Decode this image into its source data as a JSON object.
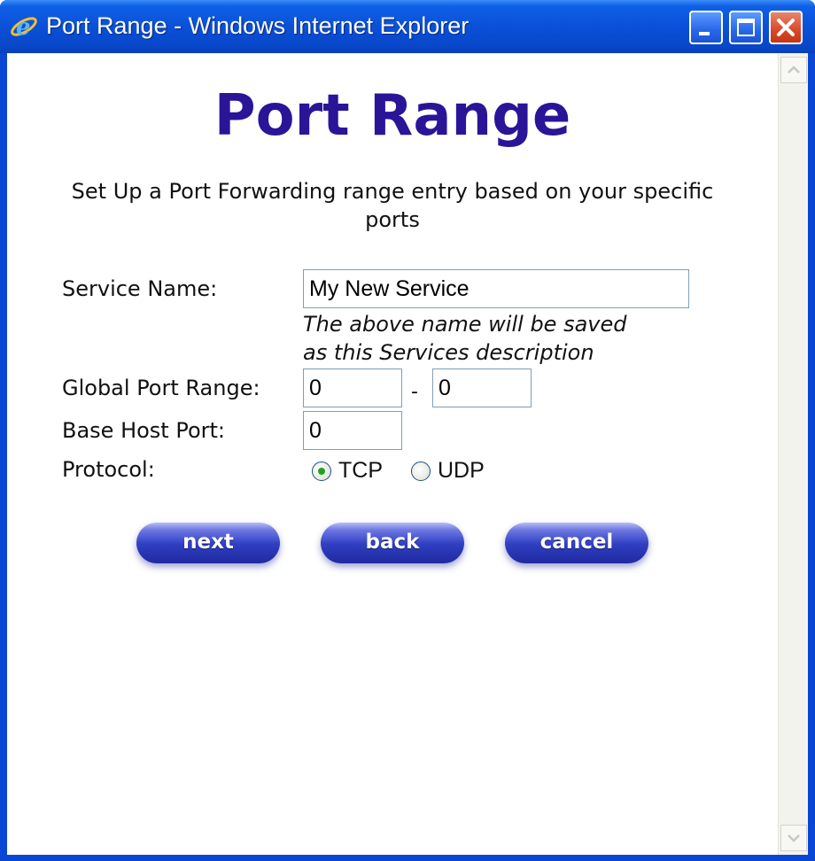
{
  "window": {
    "title": "Port Range - Windows Internet Explorer",
    "icon": "ie-logo-icon",
    "controls": [
      "minimize-icon",
      "maximize-icon",
      "close-icon"
    ]
  },
  "page": {
    "heading": "Port Range",
    "subtitle": "Set Up a Port Forwarding range entry based on your specific ports"
  },
  "form": {
    "service_name": {
      "label": "Service Name:",
      "value": "My New Service",
      "hint_line1": "The above name will be saved",
      "hint_line2": "as this Services description"
    },
    "global_port_range": {
      "label": "Global Port Range:",
      "start": "0",
      "separator": "-",
      "end": "0"
    },
    "base_host_port": {
      "label": "Base Host Port:",
      "value": "0"
    },
    "protocol": {
      "label": "Protocol:",
      "options": [
        "TCP",
        "UDP"
      ],
      "selected": "TCP"
    }
  },
  "buttons": {
    "next": "next",
    "back": "back",
    "cancel": "cancel"
  },
  "colors": {
    "heading": "#2a1598",
    "titlebar": "#0a4fd6",
    "button": "#3140c2",
    "radio_selected": "#21a121"
  }
}
